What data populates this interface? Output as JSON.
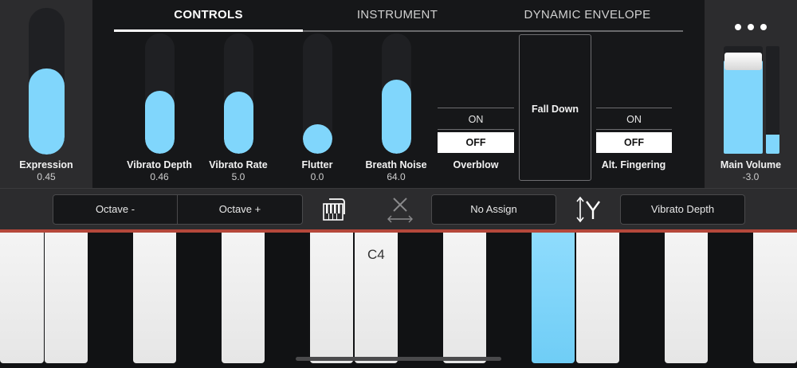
{
  "tabs": [
    {
      "label": "CONTROLS",
      "active": true
    },
    {
      "label": "INSTRUMENT",
      "active": false
    },
    {
      "label": "DYNAMIC ENVELOPE",
      "active": false
    }
  ],
  "expression": {
    "label": "Expression",
    "value": "0.45",
    "level": 0.45
  },
  "sliders": [
    {
      "label": "Vibrato Depth",
      "value": "0.46",
      "level": 0.37
    },
    {
      "label": "Vibrato Rate",
      "value": "5.0",
      "level": 0.36
    },
    {
      "label": "Flutter",
      "value": "0.0",
      "level": 0.0
    },
    {
      "label": "Breath Noise",
      "value": "64.0",
      "level": 0.49
    }
  ],
  "overblow": {
    "label": "Overblow",
    "on_label": "ON",
    "off_label": "OFF",
    "selected": "OFF"
  },
  "fall_down": {
    "label": "Fall Down"
  },
  "alt_fingering": {
    "label": "Alt. Fingering",
    "on_label": "ON",
    "off_label": "OFF",
    "selected": "OFF"
  },
  "main_volume": {
    "label": "Main Volume",
    "value": "-3.0",
    "level": 0.87,
    "meter_level": 0.18
  },
  "more_menu": {
    "icon": "more-horizontal-icon"
  },
  "toolbar": {
    "octave_minus": "Octave -",
    "octave_plus": "Octave +",
    "keyboard_icon": "keyboard-range-icon",
    "x_assign_icon": "x-axis-icon",
    "x_assign_label": "No Assign",
    "y_assign_icon": "y-axis-icon",
    "y_assign_label": "Vibrato Depth"
  },
  "keyboard": {
    "c4_label": "C4",
    "pressed_key": "F4"
  },
  "colors": {
    "accent": "#80d6fc",
    "track": "#1f2023",
    "panel": "#2c2c2e",
    "background": "#161719",
    "keyboard_edge": "#b5483b"
  }
}
